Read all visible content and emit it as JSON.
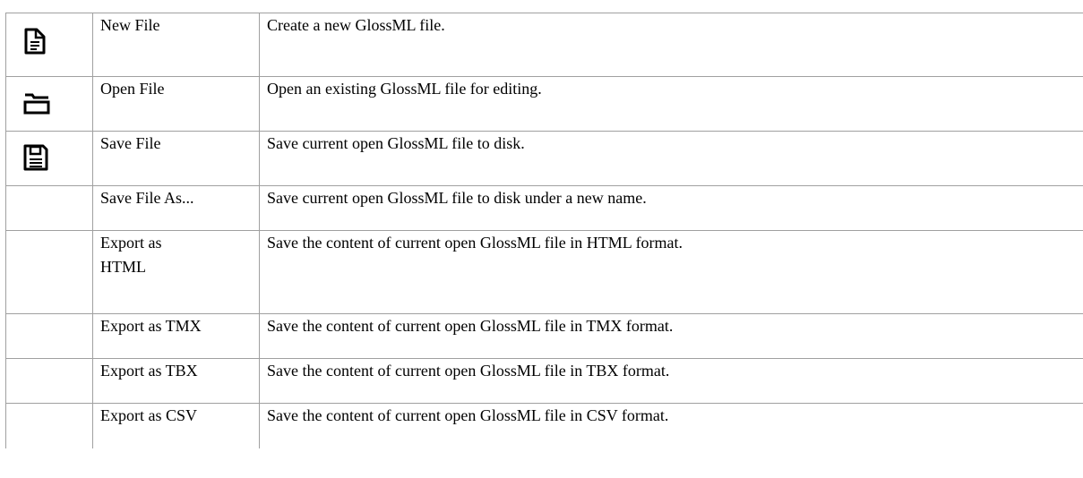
{
  "rows": [
    {
      "icon": "new-file-icon",
      "name": "New File",
      "description": "Create a new GlossML file."
    },
    {
      "icon": "open-folder-icon",
      "name": "Open File",
      "description": "Open an existing GlossML file for editing."
    },
    {
      "icon": "floppy-disk-icon",
      "name": "Save File",
      "description": "Save current open GlossML file to disk."
    },
    {
      "icon": "",
      "name": "Save File As...",
      "description": "Save current open GlossML file to disk under a new name."
    },
    {
      "icon": "",
      "name": "Export as HTML",
      "description": "Save the content of current open GlossML file in HTML format."
    },
    {
      "icon": "",
      "name": "Export as TMX",
      "description": "Save the content of current open GlossML file in TMX format."
    },
    {
      "icon": "",
      "name": "Export as TBX",
      "description": "Save the content of current open GlossML file in TBX format."
    },
    {
      "icon": "",
      "name": "Export as CSV",
      "description": "Save the content of current open GlossML file in CSV format."
    }
  ]
}
